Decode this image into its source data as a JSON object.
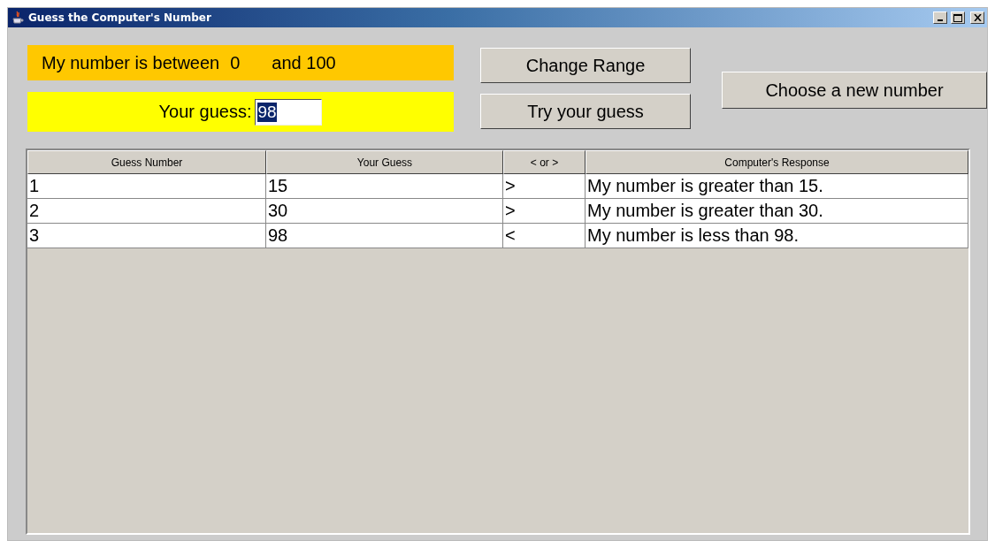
{
  "window": {
    "title": "Guess the Computer's Number"
  },
  "range": {
    "label": "My number is between",
    "low": "0",
    "high_label": "and 100"
  },
  "guess": {
    "label": "Your guess:",
    "value": "98",
    "value_selected": true
  },
  "buttons": [
    {
      "label": "Change Range"
    },
    {
      "label": "Try your guess"
    }
  ],
  "new_number_button": {
    "label": "Choose a new number"
  },
  "table": {
    "columns": [
      "Guess Number",
      "Your Guess",
      "< or >",
      "Computer's Response"
    ],
    "rows": [
      [
        "1",
        "15",
        ">",
        "My number is greater than 15."
      ],
      [
        "2",
        "30",
        ">",
        "My number is greater than 30."
      ],
      [
        "3",
        "98",
        "<",
        "My number is less than 98."
      ]
    ]
  }
}
